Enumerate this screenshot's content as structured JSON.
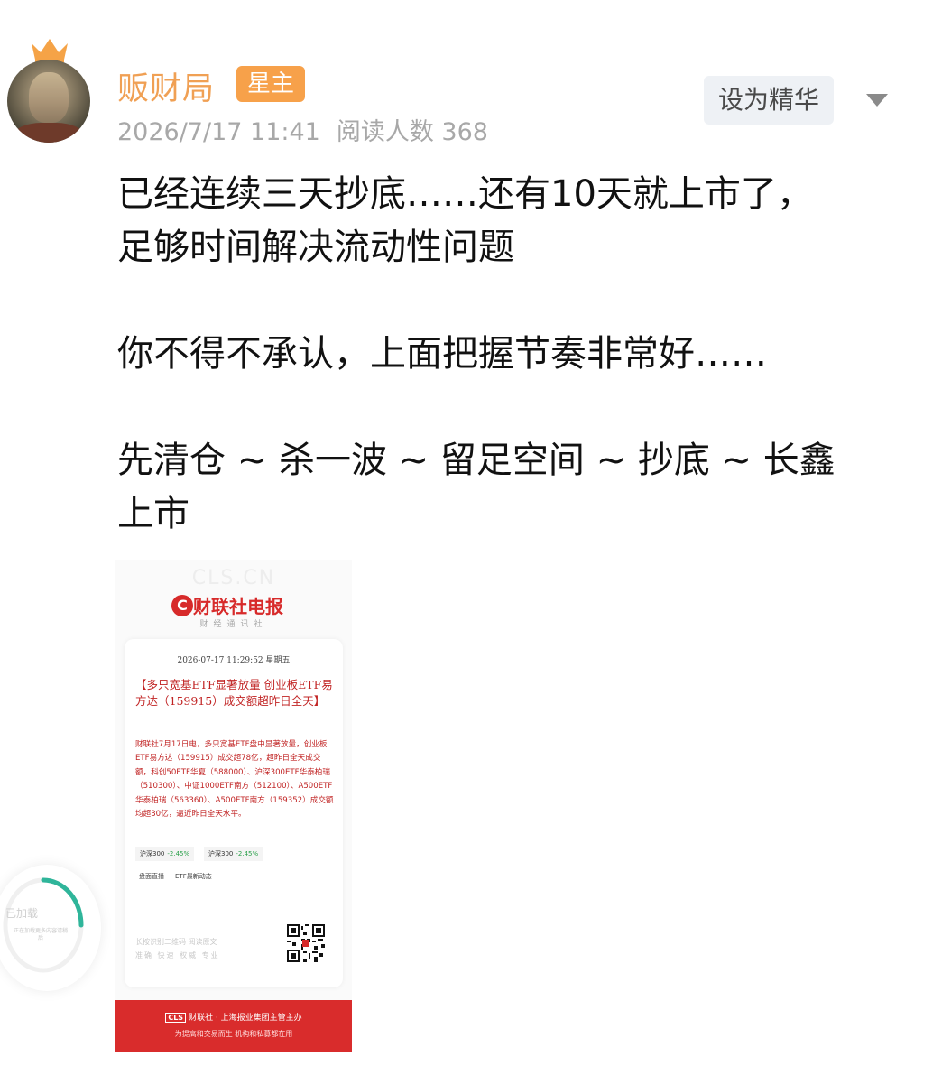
{
  "author": {
    "name": "贩财局",
    "role_badge": "星主",
    "crown_icon": "crown-icon",
    "date": "2026/7/17 11:41",
    "views": "阅读人数 368"
  },
  "actions": {
    "featured_label": "设为精华",
    "more_icon": "triangle-down-icon"
  },
  "post": {
    "p1_line1": "已经连续三天抄底……还有10天就上市了，",
    "p1_line2": "足够时间解决流动性问题",
    "p2": "你不得不承认，上面把握节奏非常好……",
    "p3_line1": "先清仓 ~ 杀一波 ~ 留足空间 ~ 抄底 ~ 长鑫",
    "p3_line2": "上市"
  },
  "attachment": {
    "watermark": "CLS.CN",
    "logo_c": "C",
    "logo_text": "财联社",
    "logo_suffix": "电报",
    "logo_sub": "财经通讯社",
    "time": "2026-07-17 11:29:52 星期五",
    "title": "【多只宽基ETF显著放量 创业板ETF易方达（159915）成交额超昨日全天】",
    "body": "财联社7月17日电，多只宽基ETF盘中显著放量，创业板ETF易方达（159915）成交超78亿，超昨日全天成交额，科创50ETF华夏（588000）、沪深300ETF华泰柏瑞（510300）、中证1000ETF南方（512100）、A500ETF华泰柏瑞（563360）、A500ETF南方（159352）成交额均超30亿，逼近昨日全天水平。",
    "chips": [
      {
        "name": "沪深300",
        "value": "-2.45%"
      },
      {
        "name": "沪深300",
        "value": "-2.45%"
      }
    ],
    "tags": [
      "盘面直播",
      "ETF最新动态"
    ],
    "foot1": "长按识别二维码 阅读原文",
    "foot2": "准确 快速 权威 专业",
    "band_badge": "CLS",
    "band_line1": "财联社 · 上海报业集团主管主办",
    "band_line2": "为提高和交易而生 机构和私募都在用"
  },
  "float_widget": {
    "label": "已加载",
    "sub": "正在加载更多内容请稍后"
  }
}
